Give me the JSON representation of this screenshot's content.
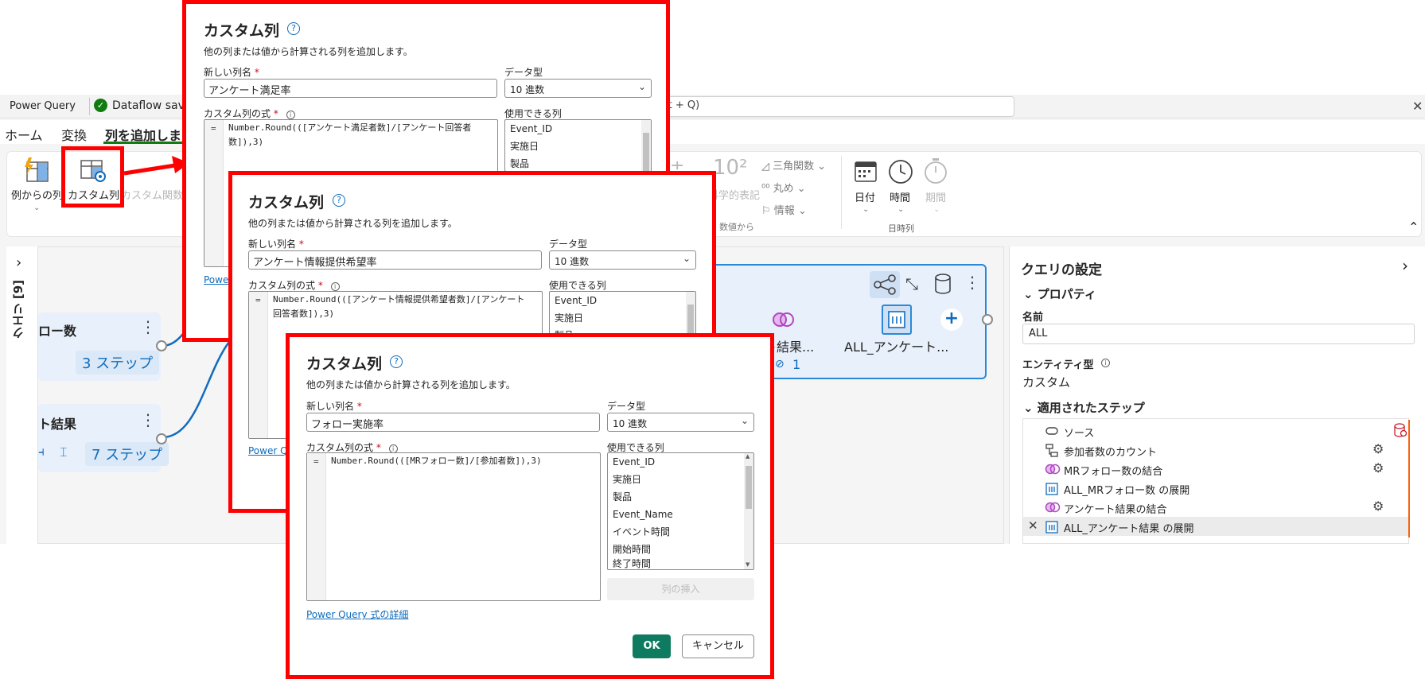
{
  "app": {
    "title": "Power Query",
    "saved_status": "Dataflow save",
    "search_hint_fragment": "lt + Q)",
    "saved_icon": "check-circle-icon",
    "close_glyph": "✕"
  },
  "menu_tabs": [
    "ホーム",
    "変換",
    "列を追加しま"
  ],
  "ribbon": {
    "example_column": "例からの列",
    "custom_column": "カスタム列",
    "custom_function": "カスタム関数",
    "numeric_10_2": "10²",
    "scientific": "科学的表記",
    "from_number": "数値から",
    "trig": "三角関数",
    "rounding": "丸め",
    "info": "情報",
    "date": "日付",
    "time": "時間",
    "duration": "期間",
    "datetime_group": "日時列",
    "collapse": "⌃"
  },
  "left_pane": {
    "expand": "›",
    "queries_label": "クエリ [9]"
  },
  "diagram": {
    "node1_title": "ロー数",
    "node1_steps": "3 ステップ",
    "node2_title": "ト結果",
    "node2_steps": "7 ステップ",
    "node_menu": "⋮",
    "main_label_1": "ト結果...",
    "main_label_2": "ALL_アンケート...",
    "main_count": "1",
    "add": "+"
  },
  "settings": {
    "title": "クエリの設定",
    "expand": "›",
    "properties_header": "プロパティ",
    "name_label": "名前",
    "name_value": "ALL",
    "entity_label": "エンティティ型",
    "entity_value": "カスタム",
    "steps_header": "適用されたステップ",
    "steps": [
      {
        "label": "ソース",
        "icon": "source-icon",
        "gear": false
      },
      {
        "label": "参加者数のカウント",
        "icon": "group-by-icon",
        "gear": true
      },
      {
        "label": "MRフォロー数の結合",
        "icon": "merge-icon",
        "gear": true
      },
      {
        "label": "ALL_MRフォロー数 の展開",
        "icon": "expand-icon",
        "gear": false
      },
      {
        "label": "アンケート結果の結合",
        "icon": "merge-icon",
        "gear": true
      },
      {
        "label": "ALL_アンケート結果 の展開",
        "icon": "expand-icon",
        "gear": false
      }
    ]
  },
  "dialogs": [
    {
      "title": "カスタム列",
      "description": "他の列または値から計算される列を追加します。",
      "new_column_label": "新しい列名",
      "new_column_value": "アンケート満足率",
      "data_type_label": "データ型",
      "data_type_value": "10 進数",
      "formula_label": "カスタム列の式",
      "formula_eq": "=",
      "formula": "Number.Round(([アンケート満足者数]/[アンケート回答者\n数]),3)",
      "columns_label": "使用できる列",
      "columns": [
        "Event_ID",
        "実施日",
        "製品"
      ],
      "link": "Power"
    },
    {
      "title": "カスタム列",
      "description": "他の列または値から計算される列を追加します。",
      "new_column_label": "新しい列名",
      "new_column_value": "アンケート情報提供希望率",
      "data_type_label": "データ型",
      "data_type_value": "10 進数",
      "formula_label": "カスタム列の式",
      "formula_eq": "=",
      "formula": "Number.Round(([アンケート情報提供希望者数]/[アンケート\n回答者数]),3)",
      "columns_label": "使用できる列",
      "columns": [
        "Event_ID",
        "実施日",
        "製品"
      ],
      "link": "Power Qu"
    },
    {
      "title": "カスタム列",
      "description": "他の列または値から計算される列を追加します。",
      "new_column_label": "新しい列名",
      "new_column_value": "フォロー実施率",
      "data_type_label": "データ型",
      "data_type_value": "10 進数",
      "formula_label": "カスタム列の式",
      "formula_eq": "=",
      "formula": "Number.Round(([MRフォロー数]/[参加者数]),3)",
      "columns_label": "使用できる列",
      "columns": [
        "Event_ID",
        "実施日",
        "製品",
        "Event_Name",
        "イベント時間",
        "開始時間",
        "終了時間"
      ],
      "insert_button": "列の挿入",
      "link": "Power Query 式の詳細",
      "ok": "OK",
      "cancel": "キャンセル"
    }
  ],
  "colors": {
    "highlight": "#ff0000",
    "primary": "#0e7a5f",
    "link": "#0f6cbd",
    "merge": "#b146c2"
  }
}
